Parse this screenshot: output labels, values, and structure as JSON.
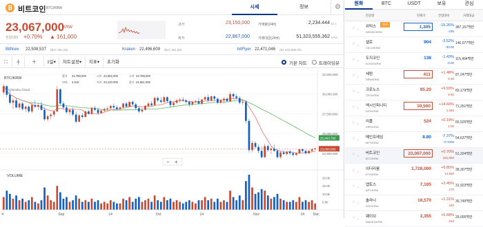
{
  "header": {
    "name": "비트코인",
    "pair": "BTC/KRW",
    "tabs": [
      "시세",
      "정보"
    ],
    "settings_icon": "gear-icon"
  },
  "info": {
    "price": "23,067,000",
    "unit": "KRW",
    "change_label": "전일대비",
    "change_pct": "+0.70%",
    "change_amt": "▲ 161,000",
    "high_label": "고가",
    "high": "23,150,000",
    "low_label": "저가",
    "low": "22,867,000",
    "vol_label": "거래량(24H)",
    "vol": "2,234.444",
    "vol_unit": "BTC",
    "amt_label": "거래대금(24H)",
    "amt": "51,323,555,362",
    "amt_unit": "KRW"
  },
  "exchanges": [
    {
      "name": "Bitfinex",
      "price": "22,508,537",
      "sub": "($17,361.00)"
    },
    {
      "name": "Kraken",
      "price": "22,496,609",
      "sub": "($17,351.80)"
    },
    {
      "name": "bitFlyer",
      "price": "22,471,046",
      "sub": "(¥2,342,606.00)"
    }
  ],
  "toolbar": {
    "interval": "1일",
    "chart_settings": "차트설정",
    "indicator": "지표",
    "reset": "초기화",
    "basic": "기본 차트",
    "tv": "트레이딩뷰"
  },
  "legend": {
    "pair": "BTC/KRW",
    "indicator": "Ichimoku Cloud",
    "close": "종가",
    "close_prev": "전일대비",
    "vol": "VOL",
    "o_l": "시가",
    "o": "23,082,000",
    "h_l": "고가",
    "h": "23,788,000",
    "l_l": "저가",
    "l": "23,120,000",
    "c_l": "종가",
    "c": "22,651,000",
    "pct": "4.01K",
    "prev": "22,788,000"
  },
  "chart_data": {
    "type": "candlestick",
    "y_ticks": [
      "32,500,000",
      "30,000,000",
      "27,500,000",
      "25,000,000",
      "22,500,000"
    ],
    "vol_ticks": [
      "20.0k",
      "15.0k",
      "10.0k",
      "5.0k"
    ],
    "x_labels": [
      "4",
      "Sep",
      "14",
      "Oct",
      "14",
      "Nov",
      "14",
      "Dec"
    ],
    "last_price": "23,068,000",
    "ma_price": "25,463,750",
    "vol_label": "VOLUME",
    "candles": [
      [
        30.2,
        31.3,
        29.9,
        31.0
      ],
      [
        31.0,
        31.1,
        29.6,
        29.9
      ],
      [
        29.9,
        30.4,
        28.7,
        28.9
      ],
      [
        28.9,
        29.5,
        28.1,
        29.2
      ],
      [
        29.2,
        29.5,
        28.2,
        28.3
      ],
      [
        28.3,
        29.0,
        28.0,
        28.8
      ],
      [
        28.8,
        29.0,
        27.9,
        28.1
      ],
      [
        28.1,
        28.6,
        27.7,
        28.4
      ],
      [
        28.4,
        28.6,
        27.6,
        27.8
      ],
      [
        27.8,
        28.9,
        27.6,
        28.6
      ],
      [
        28.6,
        29.2,
        28.2,
        28.4
      ],
      [
        28.4,
        28.9,
        28.0,
        28.6
      ],
      [
        28.6,
        29.0,
        27.9,
        28.0
      ],
      [
        28.0,
        28.3,
        26.6,
        26.8
      ],
      [
        26.8,
        27.4,
        26.5,
        27.2
      ],
      [
        27.2,
        27.6,
        26.8,
        27.4
      ],
      [
        27.4,
        27.9,
        27.1,
        27.8
      ],
      [
        27.8,
        31.0,
        27.7,
        30.6
      ],
      [
        30.6,
        30.7,
        28.6,
        28.8
      ],
      [
        28.8,
        29.1,
        28.0,
        28.3
      ],
      [
        28.3,
        28.6,
        27.5,
        27.7
      ],
      [
        27.7,
        28.2,
        27.3,
        28.0
      ],
      [
        28.0,
        28.3,
        27.2,
        27.4
      ],
      [
        27.4,
        27.8,
        26.3,
        26.5
      ],
      [
        26.5,
        27.5,
        26.4,
        27.3
      ],
      [
        27.3,
        27.6,
        26.9,
        27.1
      ],
      [
        27.1,
        27.9,
        27.0,
        27.8
      ],
      [
        27.8,
        28.0,
        27.4,
        27.5
      ],
      [
        27.5,
        28.4,
        27.4,
        28.2
      ],
      [
        28.2,
        28.5,
        27.8,
        28.0
      ],
      [
        28.0,
        28.3,
        27.4,
        27.6
      ],
      [
        27.6,
        28.1,
        27.5,
        27.9
      ],
      [
        27.9,
        28.3,
        27.7,
        28.1
      ],
      [
        28.1,
        28.4,
        27.9,
        28.2
      ],
      [
        28.2,
        28.6,
        28.0,
        28.5
      ],
      [
        28.5,
        28.8,
        28.1,
        28.3
      ],
      [
        28.3,
        28.6,
        27.9,
        28.1
      ],
      [
        28.1,
        28.4,
        27.9,
        28.3
      ],
      [
        28.3,
        28.9,
        28.2,
        28.8
      ],
      [
        28.8,
        29.0,
        28.3,
        28.4
      ],
      [
        28.4,
        29.1,
        28.3,
        29.0
      ],
      [
        29.0,
        29.2,
        28.5,
        28.7
      ],
      [
        28.7,
        28.9,
        28.0,
        28.2
      ],
      [
        28.2,
        28.5,
        27.6,
        27.8
      ],
      [
        27.8,
        28.2,
        27.6,
        28.0
      ],
      [
        28.0,
        28.6,
        27.9,
        28.5
      ],
      [
        28.5,
        29.0,
        28.3,
        28.8
      ],
      [
        28.8,
        29.1,
        28.4,
        28.6
      ],
      [
        28.6,
        29.7,
        28.5,
        29.5
      ],
      [
        29.5,
        29.7,
        29.0,
        29.2
      ],
      [
        29.2,
        29.6,
        28.8,
        29.0
      ],
      [
        29.0,
        29.8,
        28.9,
        29.6
      ],
      [
        29.6,
        29.7,
        28.9,
        29.1
      ],
      [
        29.1,
        29.3,
        28.3,
        28.6
      ],
      [
        28.6,
        29.0,
        28.4,
        28.9
      ],
      [
        28.9,
        29.4,
        28.7,
        29.2
      ],
      [
        29.2,
        29.5,
        28.9,
        29.3
      ],
      [
        29.3,
        29.6,
        29.0,
        29.2
      ],
      [
        29.2,
        29.4,
        28.8,
        29.0
      ],
      [
        29.0,
        29.2,
        28.4,
        28.7
      ],
      [
        28.7,
        29.1,
        28.5,
        29.0
      ],
      [
        29.0,
        29.3,
        28.8,
        29.1
      ],
      [
        29.1,
        29.5,
        28.7,
        28.8
      ],
      [
        28.8,
        29.4,
        28.6,
        29.3
      ],
      [
        29.3,
        29.8,
        29.2,
        29.6
      ],
      [
        29.6,
        29.9,
        29.0,
        29.2
      ],
      [
        29.2,
        29.8,
        29.1,
        29.7
      ],
      [
        29.7,
        29.8,
        29.1,
        29.4
      ],
      [
        29.4,
        29.6,
        28.7,
        28.9
      ],
      [
        28.9,
        29.4,
        28.7,
        29.2
      ],
      [
        29.2,
        29.6,
        28.8,
        29.4
      ],
      [
        29.4,
        29.6,
        29.0,
        29.1
      ],
      [
        29.1,
        30.3,
        29.0,
        30.0
      ],
      [
        30.0,
        30.2,
        29.4,
        29.7
      ],
      [
        29.7,
        30.0,
        29.3,
        29.5
      ],
      [
        29.5,
        29.7,
        28.7,
        28.9
      ],
      [
        28.9,
        29.3,
        28.6,
        29.0
      ],
      [
        29.0,
        29.2,
        26.3,
        26.6
      ],
      [
        26.6,
        26.9,
        22.6,
        22.9
      ],
      [
        22.9,
        24.1,
        22.6,
        23.8
      ],
      [
        23.8,
        24.0,
        23.1,
        23.3
      ],
      [
        23.3,
        23.6,
        22.5,
        22.8
      ],
      [
        22.8,
        23.4,
        21.8,
        22.0
      ],
      [
        22.0,
        23.7,
        21.9,
        23.4
      ],
      [
        23.4,
        23.6,
        22.7,
        22.9
      ],
      [
        22.9,
        23.3,
        22.4,
        23.1
      ],
      [
        23.1,
        23.6,
        22.7,
        22.8
      ],
      [
        22.8,
        23.1,
        21.8,
        22.0
      ],
      [
        22.0,
        22.8,
        21.8,
        22.6
      ],
      [
        22.6,
        22.9,
        22.3,
        22.4
      ],
      [
        22.4,
        22.8,
        22.2,
        22.7
      ],
      [
        22.7,
        22.9,
        22.3,
        22.5
      ],
      [
        22.5,
        22.7,
        22.1,
        22.3
      ],
      [
        22.3,
        22.6,
        22.1,
        22.5
      ],
      [
        22.5,
        23.1,
        22.4,
        23.0
      ],
      [
        23.0,
        23.1,
        22.6,
        22.8
      ],
      [
        22.8,
        23.0,
        22.3,
        22.5
      ],
      [
        22.5,
        22.9,
        22.4,
        22.8
      ],
      [
        22.8,
        23.2,
        22.7,
        23.0
      ],
      [
        23.0,
        23.2,
        22.8,
        23.1
      ]
    ],
    "volumes": [
      [
        8,
        "u"
      ],
      [
        12,
        "d"
      ],
      [
        10,
        "d"
      ],
      [
        7,
        "u"
      ],
      [
        9,
        "d"
      ],
      [
        6,
        "u"
      ],
      [
        7,
        "d"
      ],
      [
        5,
        "u"
      ],
      [
        6,
        "d"
      ],
      [
        8,
        "u"
      ],
      [
        5,
        "d"
      ],
      [
        4,
        "u"
      ],
      [
        6,
        "d"
      ],
      [
        14,
        "d"
      ],
      [
        9,
        "u"
      ],
      [
        6,
        "u"
      ],
      [
        5,
        "u"
      ],
      [
        15,
        "u"
      ],
      [
        11,
        "d"
      ],
      [
        7,
        "d"
      ],
      [
        8,
        "d"
      ],
      [
        5,
        "u"
      ],
      [
        6,
        "d"
      ],
      [
        9,
        "d"
      ],
      [
        7,
        "u"
      ],
      [
        5,
        "d"
      ],
      [
        6,
        "u"
      ],
      [
        5,
        "d"
      ],
      [
        7,
        "u"
      ],
      [
        5,
        "d"
      ],
      [
        6,
        "d"
      ],
      [
        4,
        "u"
      ],
      [
        5,
        "u"
      ],
      [
        4,
        "u"
      ],
      [
        6,
        "u"
      ],
      [
        5,
        "d"
      ],
      [
        4,
        "d"
      ],
      [
        4,
        "u"
      ],
      [
        7,
        "u"
      ],
      [
        6,
        "d"
      ],
      [
        8,
        "u"
      ],
      [
        5,
        "d"
      ],
      [
        7,
        "d"
      ],
      [
        8,
        "d"
      ],
      [
        5,
        "u"
      ],
      [
        6,
        "u"
      ],
      [
        7,
        "u"
      ],
      [
        5,
        "d"
      ],
      [
        9,
        "u"
      ],
      [
        6,
        "d"
      ],
      [
        5,
        "d"
      ],
      [
        8,
        "u"
      ],
      [
        6,
        "d"
      ],
      [
        7,
        "d"
      ],
      [
        5,
        "u"
      ],
      [
        6,
        "u"
      ],
      [
        5,
        "u"
      ],
      [
        4,
        "d"
      ],
      [
        5,
        "d"
      ],
      [
        6,
        "d"
      ],
      [
        5,
        "u"
      ],
      [
        4,
        "u"
      ],
      [
        6,
        "d"
      ],
      [
        6,
        "u"
      ],
      [
        8,
        "u"
      ],
      [
        6,
        "d"
      ],
      [
        7,
        "u"
      ],
      [
        5,
        "d"
      ],
      [
        7,
        "d"
      ],
      [
        5,
        "u"
      ],
      [
        6,
        "u"
      ],
      [
        5,
        "d"
      ],
      [
        12,
        "u"
      ],
      [
        8,
        "d"
      ],
      [
        6,
        "d"
      ],
      [
        9,
        "d"
      ],
      [
        6,
        "u"
      ],
      [
        18,
        "d"
      ],
      [
        22,
        "d"
      ],
      [
        14,
        "u"
      ],
      [
        10,
        "d"
      ],
      [
        11,
        "d"
      ],
      [
        13,
        "d"
      ],
      [
        12,
        "u"
      ],
      [
        9,
        "d"
      ],
      [
        7,
        "u"
      ],
      [
        8,
        "d"
      ],
      [
        10,
        "d"
      ],
      [
        7,
        "u"
      ],
      [
        6,
        "d"
      ],
      [
        5,
        "u"
      ],
      [
        5,
        "d"
      ],
      [
        6,
        "d"
      ],
      [
        5,
        "u"
      ],
      [
        8,
        "u"
      ],
      [
        5,
        "d"
      ],
      [
        6,
        "d"
      ],
      [
        5,
        "u"
      ],
      [
        6,
        "u"
      ],
      [
        4,
        "u"
      ]
    ]
  },
  "market": {
    "tabs": [
      "원화",
      "BTC",
      "USDT",
      "보유",
      "관심"
    ],
    "head": {
      "name": "한글명",
      "price": "현재가",
      "change": "전일대비",
      "volume": "거래대금"
    },
    "rows": [
      {
        "name": "위믹스",
        "pair": "WEMIX/KRW",
        "price": "1,305",
        "pct": "-15.26%",
        "amt": "-235",
        "vol": "387,157백만",
        "dir": "dn",
        "box": true,
        "badge": "유의"
      },
      {
        "name": "셀로",
        "pair": "CELO/KRW",
        "price": "904",
        "pct": "-3.52%",
        "amt": "-33.00",
        "vol": "146,077백만",
        "dir": "dn",
        "box": false
      },
      {
        "name": "도지코인",
        "pair": "DOGE/KRW",
        "price": "138",
        "pct": "-1.43%",
        "amt": "-2.00",
        "vol": "115,494백만",
        "dir": "dn",
        "box": false
      },
      {
        "name": "세럼",
        "pair": "SRM/KRW",
        "price": "411",
        "pct": "+1.48%",
        "amt": "6.00",
        "vol": "87,247백만",
        "dir": "up",
        "box": true
      },
      {
        "name": "크로노스",
        "pair": "CRO/KRW",
        "price": "95.20",
        "pct": "+9.93%",
        "amt": "8.60",
        "vol": "83,179백만",
        "dir": "up",
        "box": false
      },
      {
        "name": "엑시인피니티",
        "pair": "AXS/KRW",
        "price": "10,560",
        "pct": "+14.60%",
        "amt": "1,345",
        "vol": "71,251백만",
        "dir": "up",
        "box": true
      },
      {
        "name": "리플",
        "pair": "XRP/KRW",
        "price": "524",
        "pct": "+0.19%",
        "amt": "1.00",
        "vol": "65,525백만",
        "dir": "up",
        "box": false
      },
      {
        "name": "메인프레임",
        "pair": "MFT/KRW",
        "price": "8.80",
        "pct": "-7.37%",
        "amt": "-0.7000",
        "vol": "54,637백만",
        "dir": "dn",
        "box": false
      },
      {
        "name": "비트코인",
        "pair": "BTC/KRW",
        "price": "23,067,000",
        "pct": "+0.70%",
        "amt": "161,000",
        "vol": "51,324백만",
        "dir": "up",
        "box": true,
        "sel": true
      },
      {
        "name": "이더리움",
        "pair": "ETH/KRW",
        "price": "1,728,000",
        "pct": "+0.85%",
        "amt": "14,500",
        "vol": "38,307백만",
        "dir": "up",
        "box": false
      },
      {
        "name": "앱토스",
        "pair": "APT/KRW",
        "price": "7,105",
        "pct": "+2.45%",
        "amt": "170",
        "vol": "31,923백만",
        "dir": "up",
        "box": false
      },
      {
        "name": "솔라나",
        "pair": "SOL/KRW",
        "price": "18,570",
        "pct": "+1.31%",
        "amt": "240",
        "vol": "30,749백만",
        "dir": "up",
        "box": false
      },
      {
        "name": "웨이브",
        "pair": "WAVES/KRW",
        "price": "3,355",
        "pct": "+6.68%",
        "amt": "210",
        "vol": "29,005백만",
        "dir": "up",
        "box": false
      }
    ]
  }
}
